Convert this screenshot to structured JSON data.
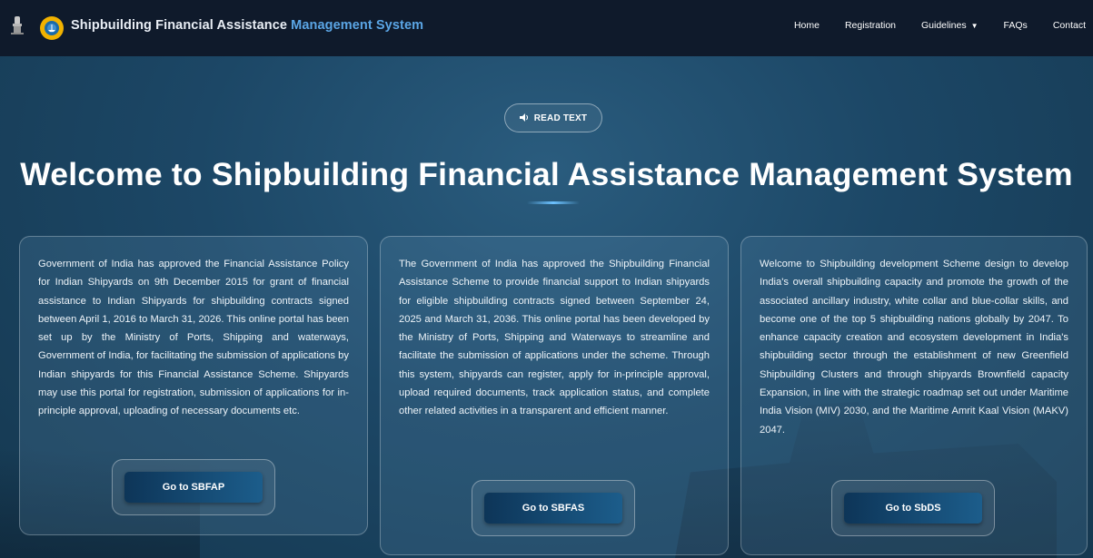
{
  "header": {
    "title_main": "Shipbuilding Financial Assistance ",
    "title_accent": "Management System"
  },
  "nav": {
    "items": [
      "Home",
      "Registration",
      "Guidelines",
      "FAQs",
      "Contact"
    ],
    "guidelines_caret": "▼"
  },
  "read_text": {
    "label": "READ TEXT",
    "icon": "speaker-icon"
  },
  "hero": {
    "headline": "Welcome to Shipbuilding Financial Assistance Management System"
  },
  "cards": [
    {
      "text": "Government of India has approved the Financial Assistance Policy for Indian Shipyards on 9th December 2015 for grant of financial assistance to Indian Shipyards for shipbuilding contracts signed between April 1, 2016 to March 31, 2026. This online portal has been set up by the Ministry of Ports, Shipping and waterways, Government of India, for facilitating the submission of applications by Indian shipyards for this Financial Assistance Scheme. Shipyards may use this portal for registration, submission of applications for in-principle approval, uploading of necessary documents etc.",
      "button": "Go to SBFAP"
    },
    {
      "text": "The Government of India has approved the Shipbuilding Financial Assistance Scheme to provide financial support to Indian shipyards for eligible shipbuilding contracts signed between September 24, 2025 and March 31, 2036. This online portal has been developed by the Ministry of Ports, Shipping and Waterways to streamline and facilitate the submission of applications under the scheme. Through this system, shipyards can register, apply for in-principle approval, upload required documents, track application status, and complete other related activities in a transparent and efficient manner.",
      "button": "Go to SBFAS"
    },
    {
      "text": "Welcome to Shipbuilding development Scheme design to develop India's overall shipbuilding capacity and promote the growth of the associated ancillary industry, white collar and blue-collar skills, and become one of the top 5 shipbuilding nations globally by 2047. To enhance capacity creation and ecosystem development in India's shipbuilding sector through the establishment of new Greenfield Shipbuilding Clusters and through shipyards Brownfield capacity Expansion, in line with the strategic roadmap set out under Maritime India Vision (MIV) 2030, and the Maritime Amrit Kaal Vision (MAKV) 2047.",
      "button": "Go to SbDS"
    }
  ],
  "colors": {
    "nav_bg": "#0f1a2b",
    "accent": "#5ba6e6",
    "logo": "#f1b200"
  }
}
